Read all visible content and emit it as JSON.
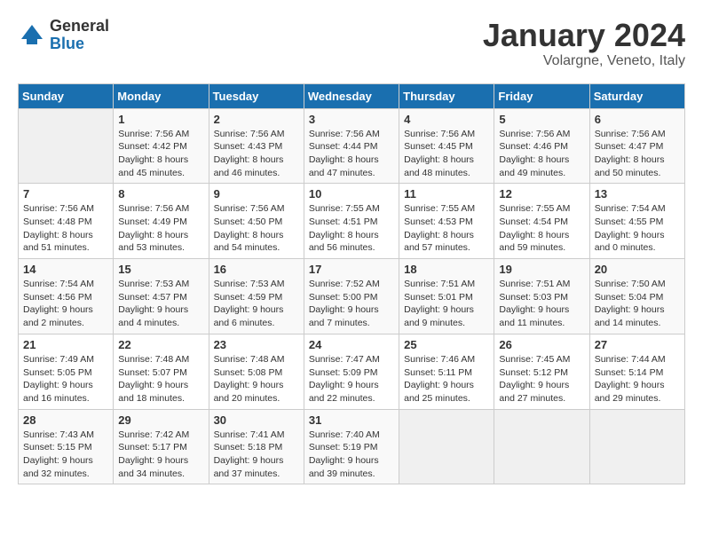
{
  "header": {
    "logo_general": "General",
    "logo_blue": "Blue",
    "month_title": "January 2024",
    "location": "Volargne, Veneto, Italy"
  },
  "days_of_week": [
    "Sunday",
    "Monday",
    "Tuesday",
    "Wednesday",
    "Thursday",
    "Friday",
    "Saturday"
  ],
  "weeks": [
    [
      {
        "day": "",
        "info": ""
      },
      {
        "day": "1",
        "info": "Sunrise: 7:56 AM\nSunset: 4:42 PM\nDaylight: 8 hours\nand 45 minutes."
      },
      {
        "day": "2",
        "info": "Sunrise: 7:56 AM\nSunset: 4:43 PM\nDaylight: 8 hours\nand 46 minutes."
      },
      {
        "day": "3",
        "info": "Sunrise: 7:56 AM\nSunset: 4:44 PM\nDaylight: 8 hours\nand 47 minutes."
      },
      {
        "day": "4",
        "info": "Sunrise: 7:56 AM\nSunset: 4:45 PM\nDaylight: 8 hours\nand 48 minutes."
      },
      {
        "day": "5",
        "info": "Sunrise: 7:56 AM\nSunset: 4:46 PM\nDaylight: 8 hours\nand 49 minutes."
      },
      {
        "day": "6",
        "info": "Sunrise: 7:56 AM\nSunset: 4:47 PM\nDaylight: 8 hours\nand 50 minutes."
      }
    ],
    [
      {
        "day": "7",
        "info": "Sunrise: 7:56 AM\nSunset: 4:48 PM\nDaylight: 8 hours\nand 51 minutes."
      },
      {
        "day": "8",
        "info": "Sunrise: 7:56 AM\nSunset: 4:49 PM\nDaylight: 8 hours\nand 53 minutes."
      },
      {
        "day": "9",
        "info": "Sunrise: 7:56 AM\nSunset: 4:50 PM\nDaylight: 8 hours\nand 54 minutes."
      },
      {
        "day": "10",
        "info": "Sunrise: 7:55 AM\nSunset: 4:51 PM\nDaylight: 8 hours\nand 56 minutes."
      },
      {
        "day": "11",
        "info": "Sunrise: 7:55 AM\nSunset: 4:53 PM\nDaylight: 8 hours\nand 57 minutes."
      },
      {
        "day": "12",
        "info": "Sunrise: 7:55 AM\nSunset: 4:54 PM\nDaylight: 8 hours\nand 59 minutes."
      },
      {
        "day": "13",
        "info": "Sunrise: 7:54 AM\nSunset: 4:55 PM\nDaylight: 9 hours\nand 0 minutes."
      }
    ],
    [
      {
        "day": "14",
        "info": "Sunrise: 7:54 AM\nSunset: 4:56 PM\nDaylight: 9 hours\nand 2 minutes."
      },
      {
        "day": "15",
        "info": "Sunrise: 7:53 AM\nSunset: 4:57 PM\nDaylight: 9 hours\nand 4 minutes."
      },
      {
        "day": "16",
        "info": "Sunrise: 7:53 AM\nSunset: 4:59 PM\nDaylight: 9 hours\nand 6 minutes."
      },
      {
        "day": "17",
        "info": "Sunrise: 7:52 AM\nSunset: 5:00 PM\nDaylight: 9 hours\nand 7 minutes."
      },
      {
        "day": "18",
        "info": "Sunrise: 7:51 AM\nSunset: 5:01 PM\nDaylight: 9 hours\nand 9 minutes."
      },
      {
        "day": "19",
        "info": "Sunrise: 7:51 AM\nSunset: 5:03 PM\nDaylight: 9 hours\nand 11 minutes."
      },
      {
        "day": "20",
        "info": "Sunrise: 7:50 AM\nSunset: 5:04 PM\nDaylight: 9 hours\nand 14 minutes."
      }
    ],
    [
      {
        "day": "21",
        "info": "Sunrise: 7:49 AM\nSunset: 5:05 PM\nDaylight: 9 hours\nand 16 minutes."
      },
      {
        "day": "22",
        "info": "Sunrise: 7:48 AM\nSunset: 5:07 PM\nDaylight: 9 hours\nand 18 minutes."
      },
      {
        "day": "23",
        "info": "Sunrise: 7:48 AM\nSunset: 5:08 PM\nDaylight: 9 hours\nand 20 minutes."
      },
      {
        "day": "24",
        "info": "Sunrise: 7:47 AM\nSunset: 5:09 PM\nDaylight: 9 hours\nand 22 minutes."
      },
      {
        "day": "25",
        "info": "Sunrise: 7:46 AM\nSunset: 5:11 PM\nDaylight: 9 hours\nand 25 minutes."
      },
      {
        "day": "26",
        "info": "Sunrise: 7:45 AM\nSunset: 5:12 PM\nDaylight: 9 hours\nand 27 minutes."
      },
      {
        "day": "27",
        "info": "Sunrise: 7:44 AM\nSunset: 5:14 PM\nDaylight: 9 hours\nand 29 minutes."
      }
    ],
    [
      {
        "day": "28",
        "info": "Sunrise: 7:43 AM\nSunset: 5:15 PM\nDaylight: 9 hours\nand 32 minutes."
      },
      {
        "day": "29",
        "info": "Sunrise: 7:42 AM\nSunset: 5:17 PM\nDaylight: 9 hours\nand 34 minutes."
      },
      {
        "day": "30",
        "info": "Sunrise: 7:41 AM\nSunset: 5:18 PM\nDaylight: 9 hours\nand 37 minutes."
      },
      {
        "day": "31",
        "info": "Sunrise: 7:40 AM\nSunset: 5:19 PM\nDaylight: 9 hours\nand 39 minutes."
      },
      {
        "day": "",
        "info": ""
      },
      {
        "day": "",
        "info": ""
      },
      {
        "day": "",
        "info": ""
      }
    ]
  ]
}
